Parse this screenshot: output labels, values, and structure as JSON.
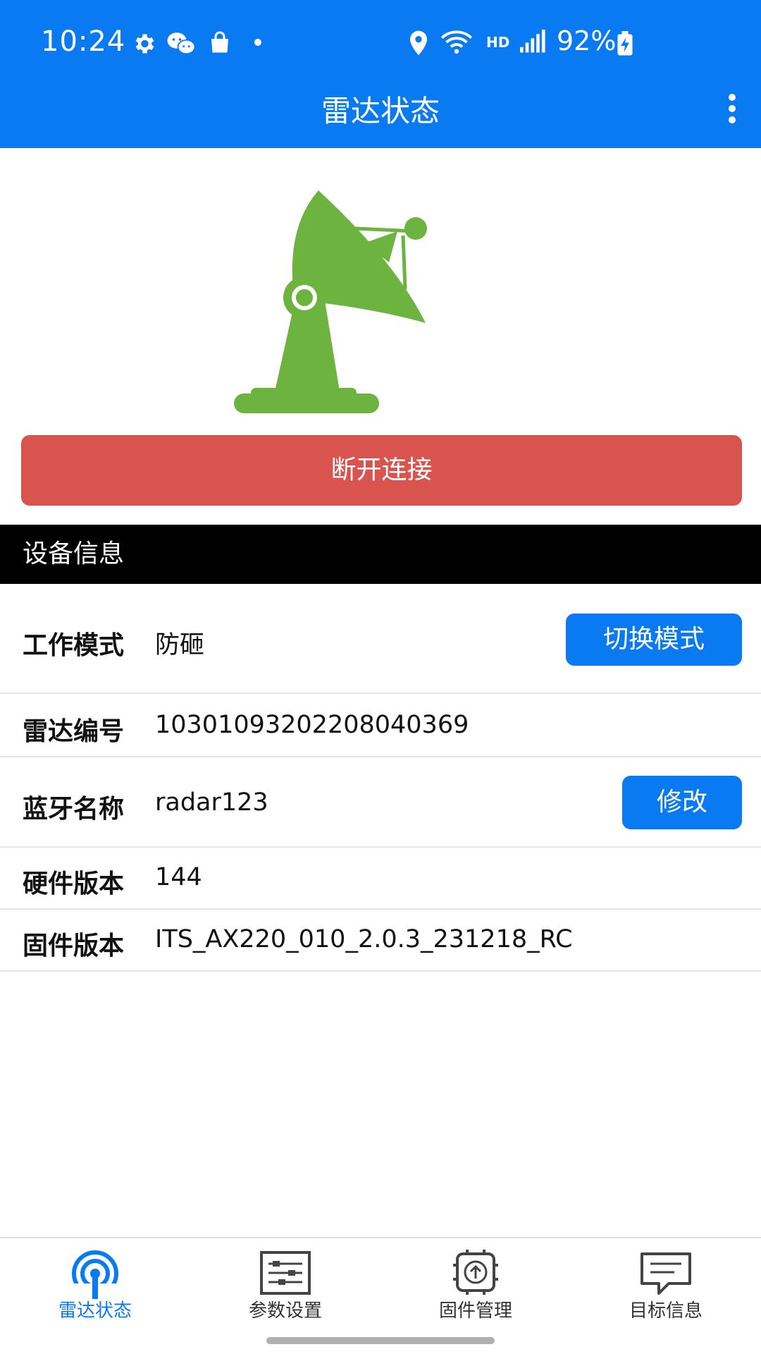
{
  "status_bar": {
    "time": "10:24",
    "battery": "92%",
    "network": "HD",
    "icons": [
      "gear-icon",
      "wechat-icon",
      "shopping-bag-icon",
      "dot-icon",
      "location-icon",
      "wifi-icon",
      "signal-icon",
      "battery-charging-icon"
    ]
  },
  "header": {
    "title": "雷达状态",
    "menu_icon": "more-vert-icon"
  },
  "disconnect_button": {
    "label": "断开连接",
    "color": "#d9534f"
  },
  "device_info": {
    "section_title": "设备信息",
    "rows": [
      {
        "label": "工作模式",
        "value": "防砸",
        "action": "切换模式"
      },
      {
        "label": "雷达编号",
        "value": "10301093202208040369"
      },
      {
        "label": "蓝牙名称",
        "value": "radar123",
        "action": "修改"
      },
      {
        "label": "硬件版本",
        "value": "144"
      },
      {
        "label": "固件版本",
        "value": "ITS_AX220_010_2.0.3_231218_RC"
      }
    ]
  },
  "tabs": [
    {
      "label": "雷达状态",
      "icon": "radar-signal-icon",
      "active": true
    },
    {
      "label": "参数设置",
      "icon": "sliders-icon",
      "active": false
    },
    {
      "label": "固件管理",
      "icon": "chip-upload-icon",
      "active": false
    },
    {
      "label": "目标信息",
      "icon": "message-icon",
      "active": false
    }
  ],
  "colors": {
    "primary": "#0a7af3",
    "danger": "#d9534f",
    "radar_green": "#6db33f"
  }
}
